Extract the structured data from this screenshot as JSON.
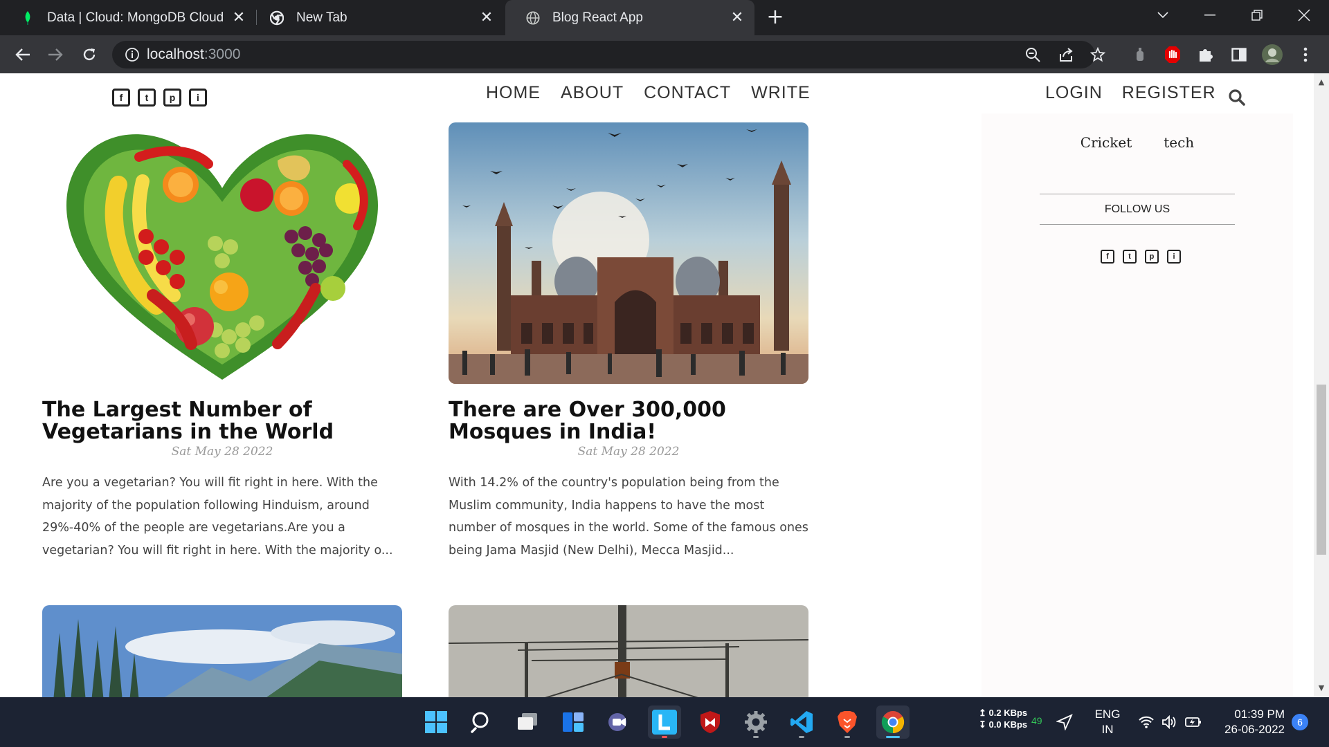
{
  "browser": {
    "tabs": [
      {
        "title": "Data | Cloud: MongoDB Cloud",
        "icon": "mongodb-leaf-icon"
      },
      {
        "title": "New Tab",
        "icon": "chrome-icon"
      },
      {
        "title": "Blog React App",
        "icon": "globe-icon"
      }
    ],
    "new_tab": "+",
    "url": {
      "host": "localhost",
      "port": ":3000"
    }
  },
  "site": {
    "top_social": [
      "f",
      "t",
      "p",
      "i"
    ],
    "menu": [
      "HOME",
      "ABOUT",
      "CONTACT",
      "WRITE"
    ],
    "auth": [
      "LOGIN",
      "REGISTER"
    ]
  },
  "sidebar": {
    "categories": [
      "Cricket",
      "tech"
    ],
    "follow_title": "FOLLOW US",
    "social": [
      "f",
      "t",
      "p",
      "i"
    ]
  },
  "posts": [
    {
      "title": "The Largest Number of Vegetarians in the World",
      "date": "Sat May 28 2022",
      "desc": "Are you a vegetarian? You will fit right in here. With the majority of the population following Hinduism, around 29%-40% of the people are vegetarians.Are you a vegetarian? You will fit right in here. With the majority o..."
    },
    {
      "title": "There are Over 300,000 Mosques in India!",
      "date": "Sat May 28 2022",
      "desc": "With 14.2% of the country's population being from the Muslim community, India happens to have the most number of mosques in the world. Some of the famous ones being Jama Masjid (New Delhi), Mecca Masjid..."
    }
  ],
  "taskbar": {
    "net_up": "0.2 KBps",
    "net_down": "0.0 KBps",
    "net_count": "49",
    "lang": "ENG",
    "region": "IN",
    "time": "01:39 PM",
    "date": "26-06-2022",
    "notifications": "6",
    "accent": "#3b82f6"
  }
}
